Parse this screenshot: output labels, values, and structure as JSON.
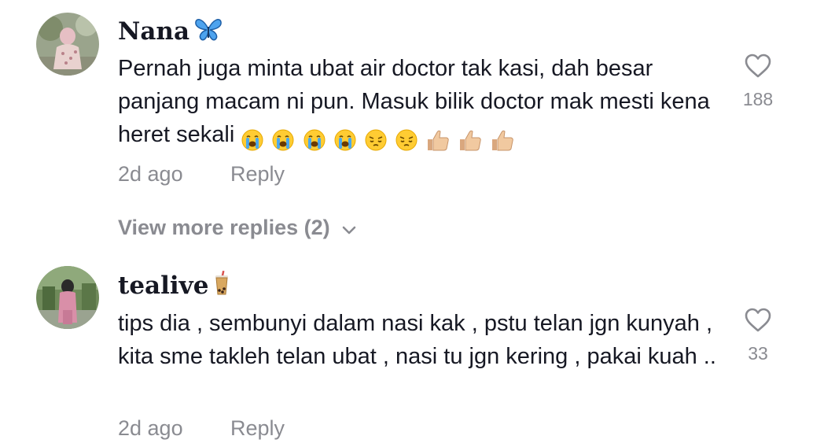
{
  "comments": [
    {
      "username": "Nana",
      "username_emoji": "butterfly-icon",
      "text": "Pernah juga minta ubat air doctor tak kasi, dah besar panjang macam ni pun. Masuk bilik doctor mak mesti kena heret sekali",
      "text_emojis": [
        "loudly-crying-face-icon",
        "loudly-crying-face-icon",
        "loudly-crying-face-icon",
        "loudly-crying-face-icon",
        "pensive-face-icon",
        "pensive-face-icon",
        "thumbs-up-icon",
        "thumbs-up-icon",
        "thumbs-up-icon"
      ],
      "time": "2d ago",
      "reply_label": "Reply",
      "likes": "188",
      "view_more_label": "View more replies (2)"
    },
    {
      "username": "tealive",
      "username_emoji": "bubble-tea-icon",
      "text": "tips dia , sembunyi dalam nasi kak , pstu telan jgn kunyah , kita sme takleh telan ubat , nasi tu jgn kering , pakai kuah ..",
      "time": "2d ago",
      "reply_label": "Reply",
      "likes": "33"
    }
  ],
  "colors": {
    "text": "#161823",
    "secondary": "#8a8b91",
    "background": "#ffffff",
    "butterfly": "#3b8fd9"
  }
}
